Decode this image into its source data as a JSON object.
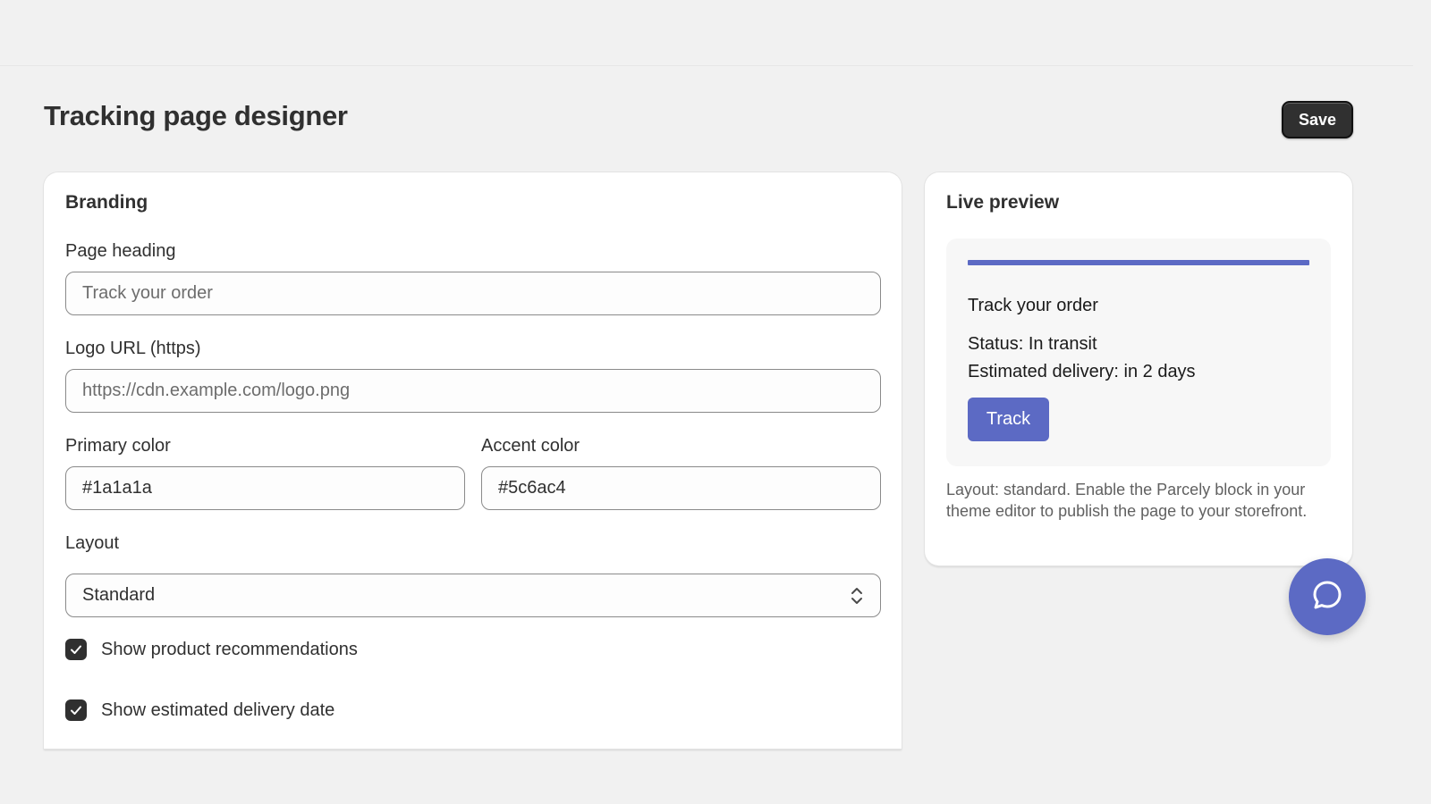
{
  "header": {
    "title": "Tracking page designer",
    "save_label": "Save"
  },
  "branding": {
    "title": "Branding",
    "page_heading": {
      "label": "Page heading",
      "placeholder": "Track your order",
      "value": ""
    },
    "logo_url": {
      "label": "Logo URL (https)",
      "placeholder": "https://cdn.example.com/logo.png",
      "value": ""
    },
    "primary_color": {
      "label": "Primary color",
      "value": "#1a1a1a"
    },
    "accent_color": {
      "label": "Accent color",
      "value": "#5c6ac4"
    },
    "layout": {
      "label": "Layout",
      "selected": "Standard"
    },
    "checkboxes": [
      {
        "label": "Show product recommendations",
        "checked": true
      },
      {
        "label": "Show estimated delivery date",
        "checked": true
      }
    ]
  },
  "preview": {
    "title": "Live preview",
    "heading": "Track your order",
    "status": "Status: In transit",
    "delivery": "Estimated delivery: in 2 days",
    "button_label": "Track",
    "help_text": "Layout: standard. Enable the Parcely block in your theme editor to publish the page to your storefront."
  },
  "icons": {
    "checkbox": "checkmark-icon",
    "select": "chevron-up-down-icon",
    "chat": "chat-bubble-icon"
  },
  "colors": {
    "accent": "#5c6ac4",
    "primary": "#1a1a1a",
    "save_button": "#303030"
  }
}
